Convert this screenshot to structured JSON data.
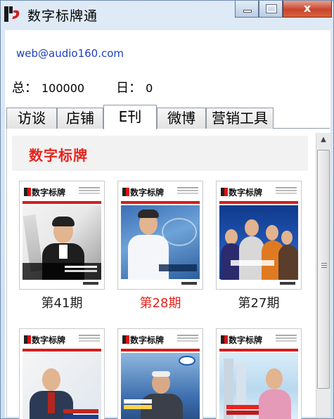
{
  "window": {
    "title": "数字标牌通",
    "controls": {
      "minimize": "minimize",
      "maximize": "maximize",
      "close": "x"
    }
  },
  "header": {
    "email": "web@audio160.com",
    "total_label": "总：",
    "total_value": "100000",
    "day_label": "日：",
    "day_value": "0"
  },
  "tabs": [
    {
      "label": "访谈"
    },
    {
      "label": "店铺"
    },
    {
      "label": "E刊",
      "active": true
    },
    {
      "label": "微博"
    },
    {
      "label": "营销工具"
    }
  ],
  "section": {
    "title": "数字标牌"
  },
  "covers": [
    {
      "masthead": "数字标牌",
      "issue": "第41期",
      "current": false,
      "photo_theme": "dark-suit-man-dark-bg"
    },
    {
      "masthead": "数字标牌",
      "issue": "第28期",
      "current": true,
      "photo_theme": "white-shirt-man-blue-bg"
    },
    {
      "masthead": "数字标牌",
      "issue": "第27期",
      "current": false,
      "photo_theme": "group-people-blue-bg"
    },
    {
      "masthead": "数字标牌",
      "issue": "",
      "current": false,
      "photo_theme": "suit-man-light-bg"
    },
    {
      "masthead": "数字标牌",
      "issue": "",
      "current": false,
      "photo_theme": "suit-man-screens-bg"
    },
    {
      "masthead": "数字标牌",
      "issue": "",
      "current": false,
      "photo_theme": "pink-shirt-man-sky-bg"
    }
  ],
  "colors": {
    "accent_red": "#e8231c",
    "link_blue": "#1f3fbf",
    "titlebar": "#cddff1"
  },
  "icons": {
    "app_logo": "app-logo-icon",
    "scroll_up": "scroll-up-arrow-icon"
  }
}
